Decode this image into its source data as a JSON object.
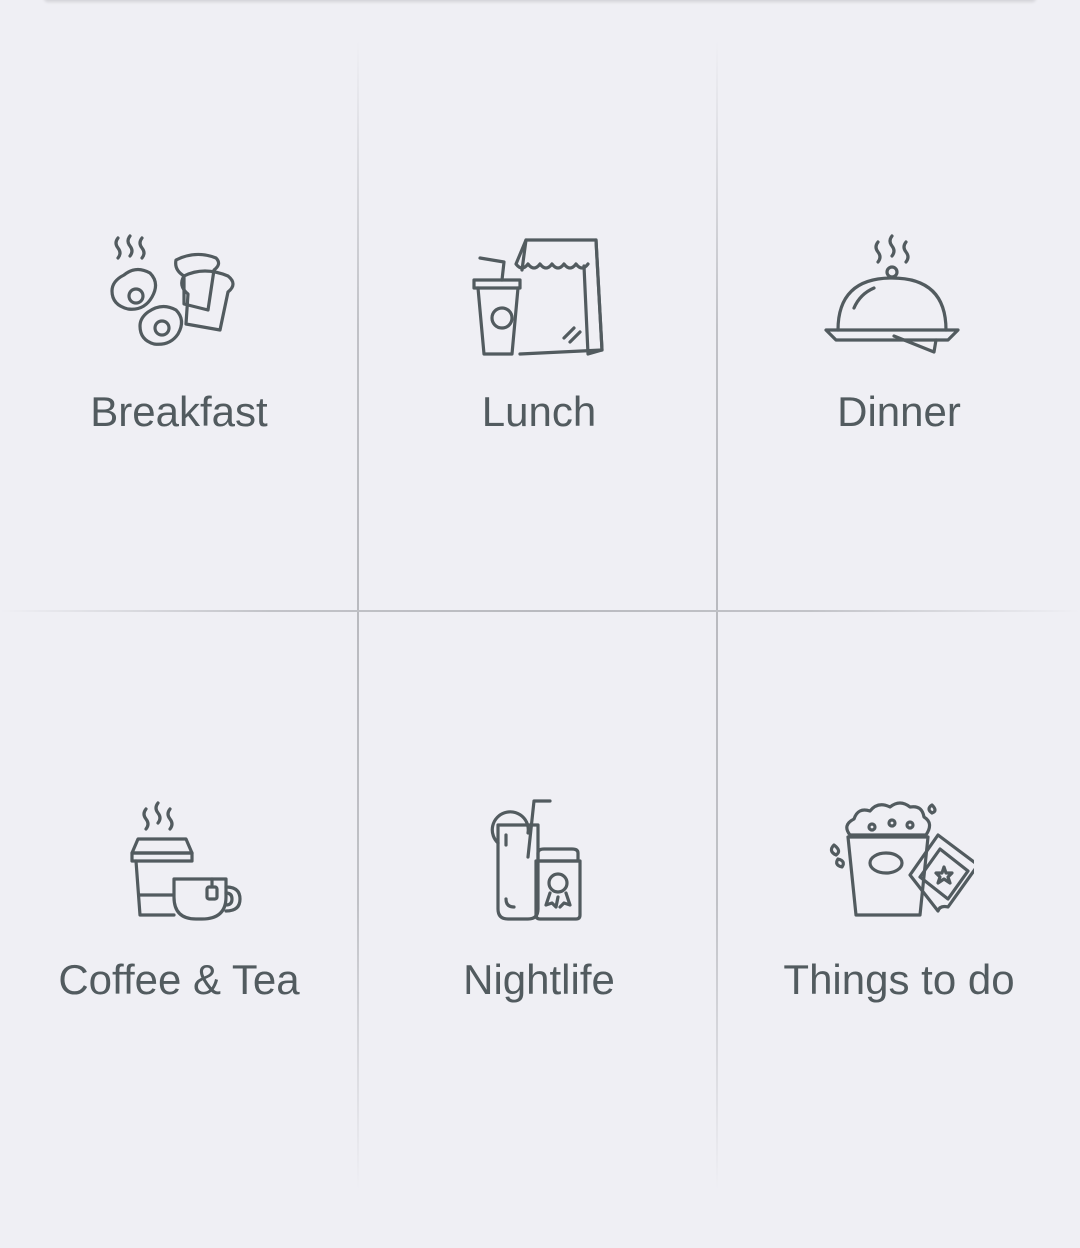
{
  "categories": [
    {
      "id": "breakfast",
      "label": "Breakfast",
      "icon": "breakfast-icon"
    },
    {
      "id": "lunch",
      "label": "Lunch",
      "icon": "lunch-bag-drink-icon"
    },
    {
      "id": "dinner",
      "label": "Dinner",
      "icon": "cloche-dinner-icon"
    },
    {
      "id": "coffee-tea",
      "label": "Coffee & Tea",
      "icon": "coffee-tea-cups-icon"
    },
    {
      "id": "nightlife",
      "label": "Nightlife",
      "icon": "drinks-nightlife-icon"
    },
    {
      "id": "things-to-do",
      "label": "Things to do",
      "icon": "popcorn-ticket-icon"
    }
  ],
  "colors": {
    "background": "#efeff4",
    "icon_stroke": "#525b5f",
    "label_text": "#525b5f",
    "divider": "#bfc0c5"
  }
}
